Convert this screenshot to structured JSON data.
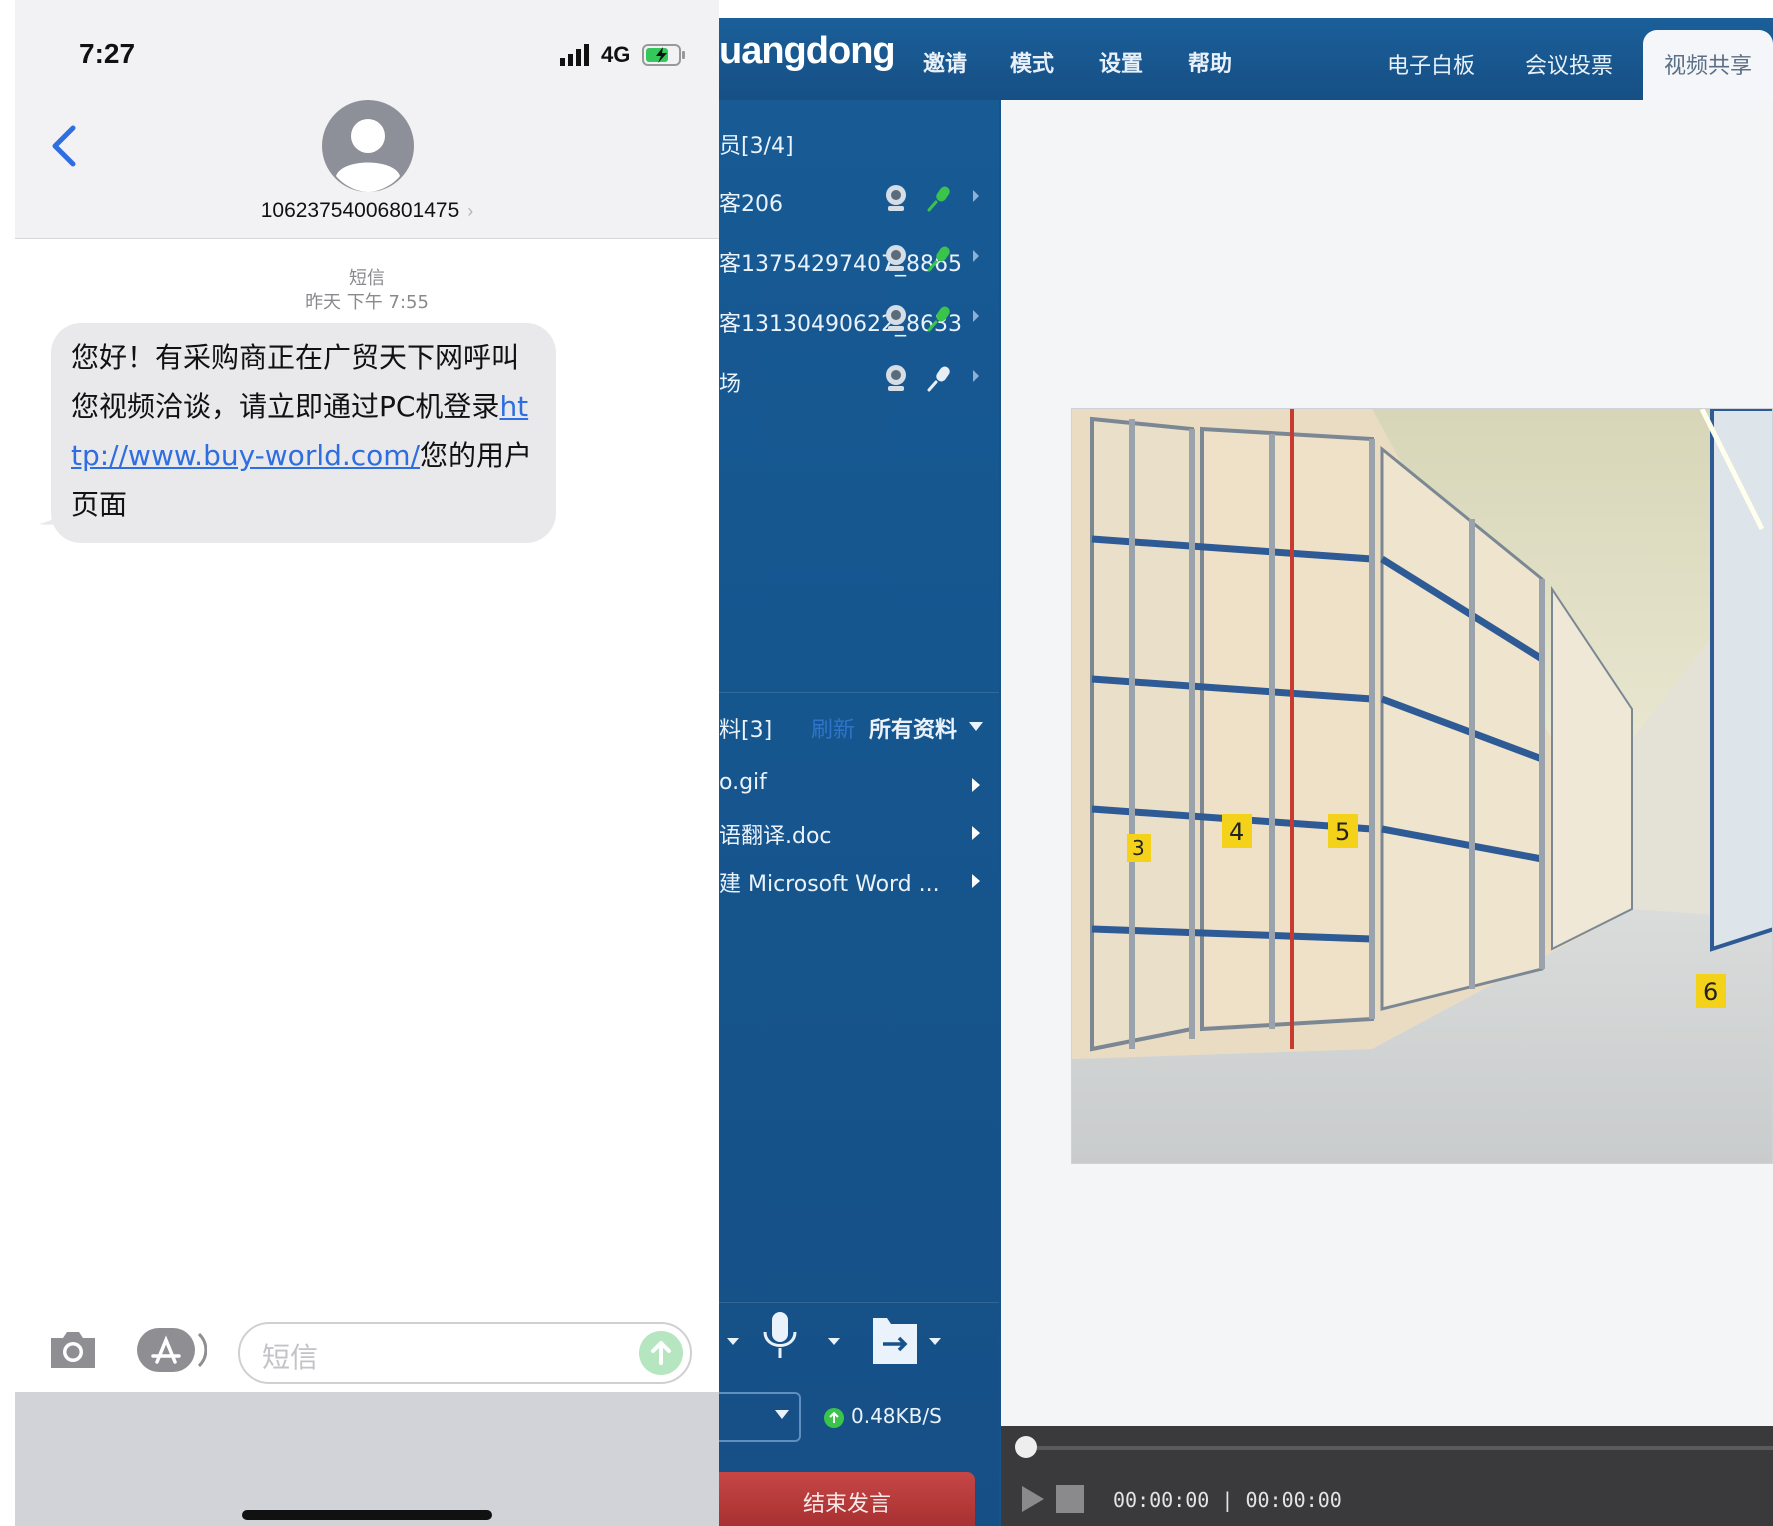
{
  "phone": {
    "status_time": "7:27",
    "network": "4G",
    "contact_number": "10623754006801475",
    "service_label": "短信",
    "timestamp": "昨天 下午 7:55",
    "message_text_before": "您好！有采购商正在广贸天下网呼叫您视频洽谈，请立即通过PC机登录",
    "message_link": "http://www.buy-world.com/",
    "message_text_after": "您的用户页面",
    "input_placeholder": "短信",
    "accent_color": "#2e6ee0"
  },
  "conference": {
    "brand": "uangdong",
    "menu": [
      "邀请",
      "模式",
      "设置",
      "帮助"
    ],
    "tabs": [
      "电子白板",
      "会议投票",
      "视频共享"
    ],
    "active_tab": "视频共享",
    "members_header": "员[3/4]",
    "members": [
      {
        "name": "客206"
      },
      {
        "name": "客13754297407_8865"
      },
      {
        "name": "客13130490622_8633"
      },
      {
        "name": "场"
      }
    ],
    "docs_header": "料[3]",
    "docs_refresh": "刷新",
    "docs_filter": "所有资料",
    "docs": [
      "o.gif",
      "语翻译.doc",
      "建 Microsoft Word ..."
    ],
    "rate": "0.48KB/S",
    "end_button": "结束发言",
    "player_time": "00:00:00 | 00:00:00",
    "rack_labels": [
      "3",
      "4",
      "5",
      "6"
    ],
    "end_button_color": "#b83a3a"
  }
}
